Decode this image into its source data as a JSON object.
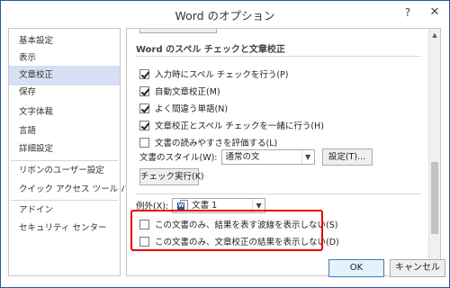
{
  "window": {
    "title": "Word のオプション",
    "help_glyph": "?",
    "close_glyph": "✕"
  },
  "sidebar": {
    "items": [
      {
        "label": "基本設定"
      },
      {
        "label": "表示"
      },
      {
        "label": "文章校正",
        "selected": true
      },
      {
        "label": "保存"
      },
      {
        "label": "文字体裁"
      },
      {
        "label": "言語"
      },
      {
        "label": "詳細設定"
      },
      {
        "label": "リボンのユーザー設定"
      },
      {
        "label": "クイック アクセス ツール バー"
      },
      {
        "label": "アドイン"
      },
      {
        "label": "セキュリティ センター"
      }
    ]
  },
  "main": {
    "section_title": "Word のスペル チェックと文章校正",
    "options": [
      {
        "label": "入力時にスペル チェックを行う(P)",
        "checked": true
      },
      {
        "label": "自動文章校正(M)",
        "checked": true
      },
      {
        "label": "よく間違う単語(N)",
        "checked": true
      },
      {
        "label": "文章校正とスペル チェックを一緒に行う(H)",
        "checked": true
      },
      {
        "label": "文書の読みやすさを評価する(L)",
        "checked": false
      }
    ],
    "writing_style_label": "文書のスタイル(W):",
    "writing_style_value": "通常の文",
    "settings_button": "設定(T)...",
    "check_document_button": "チェック実行(K)",
    "exceptions_label": "例外(X):",
    "exceptions_document": "文書 1",
    "doc_icon_letter": "W",
    "exception_options": [
      {
        "label": "この文書のみ、結果を表す波線を表示しない(S)",
        "checked": false
      },
      {
        "label": "この文書のみ、文章校正の結果を表示しない(D)",
        "checked": false
      }
    ]
  },
  "scrollbar": {
    "up_glyph": "▲",
    "down_glyph": "▼"
  },
  "footer": {
    "ok_label": "OK",
    "cancel_label": "キャンセル"
  },
  "colors": {
    "accent": "#2b579a",
    "selection": "#d5e1f2",
    "highlight_box": "#e60000"
  }
}
